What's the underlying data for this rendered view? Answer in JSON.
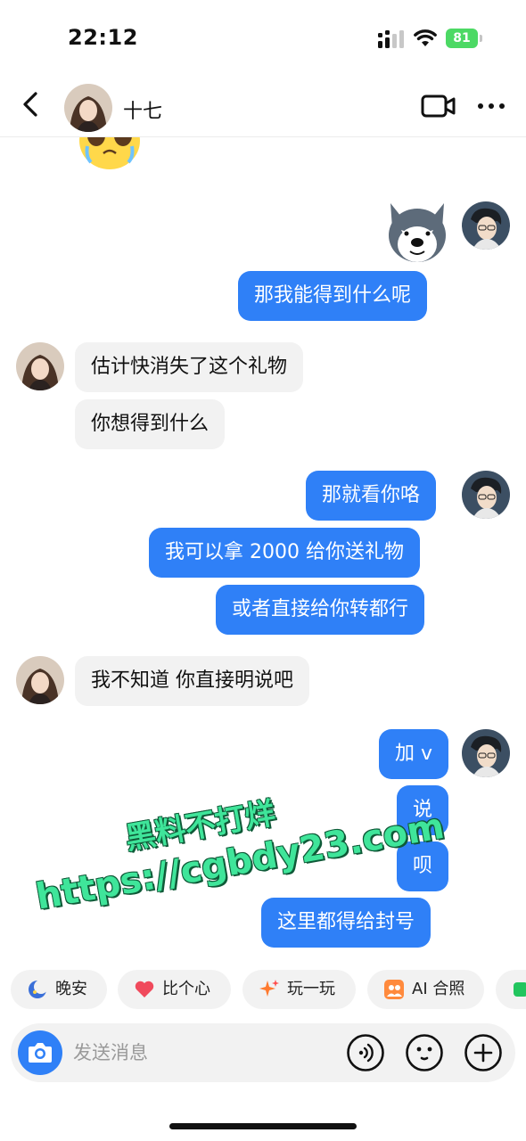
{
  "status_bar": {
    "time": "22:12",
    "battery": "81"
  },
  "header": {
    "contact_name": "十七"
  },
  "messages": [
    {
      "side": "in",
      "kind": "emoji",
      "icon": "crying-face-emoji"
    },
    {
      "side": "out",
      "kind": "sticker",
      "icon": "husky-dog-sticker"
    },
    {
      "side": "out",
      "kind": "text",
      "text": "那我能得到什么呢"
    },
    {
      "side": "in",
      "kind": "text",
      "text": "估计快消失了这个礼物"
    },
    {
      "side": "in",
      "kind": "text",
      "text": "你想得到什么"
    },
    {
      "side": "out",
      "kind": "text",
      "text": "那就看你咯"
    },
    {
      "side": "out",
      "kind": "text",
      "text": "我可以拿 2000 给你送礼物"
    },
    {
      "side": "out",
      "kind": "text",
      "text": "或者直接给你转都行"
    },
    {
      "side": "in",
      "kind": "text",
      "text": "我不知道 你直接明说吧"
    },
    {
      "side": "out",
      "kind": "text",
      "text": "加 v"
    },
    {
      "side": "out",
      "kind": "text",
      "text": "说"
    },
    {
      "side": "out",
      "kind": "text",
      "text": "呗"
    },
    {
      "side": "out",
      "kind": "text",
      "text": "这里都得给封号"
    }
  ],
  "watermark": {
    "line1": "黑料不打烊",
    "line2": "https://cgbdy23.com"
  },
  "quick_replies": [
    {
      "label": "晚安",
      "icon": "moon-icon"
    },
    {
      "label": "比个心",
      "icon": "heart-icon"
    },
    {
      "label": "玩一玩",
      "icon": "sparkle-icon"
    },
    {
      "label": "AI 合照",
      "icon": "portrait-icon"
    }
  ],
  "input": {
    "placeholder": "发送消息"
  },
  "colors": {
    "outgoing_bubble": "#2f80f7",
    "incoming_bubble": "#f2f2f2",
    "watermark": "#3fe59a"
  }
}
